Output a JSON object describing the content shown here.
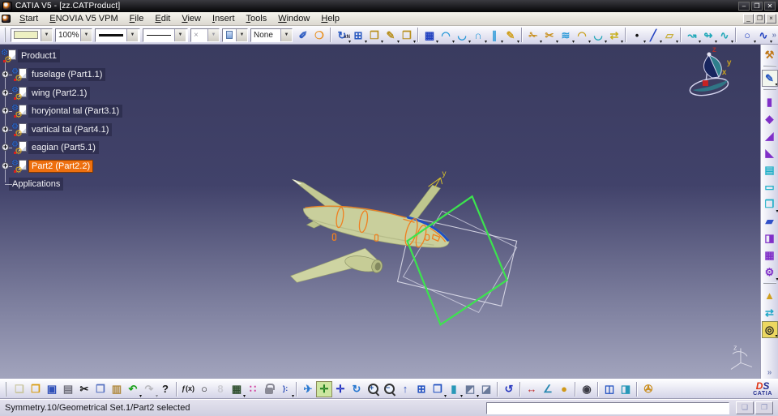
{
  "window": {
    "title": "CATIA V5 - [zz.CATProduct]",
    "controls": {
      "minimize": "–",
      "maximize": "❐",
      "close": "✕"
    },
    "child_controls": {
      "minimize": "_",
      "restore": "❐",
      "close": "×"
    }
  },
  "menu": {
    "items": [
      "Start",
      "ENOVIA V5 VPM",
      "File",
      "Edit",
      "View",
      "Insert",
      "Tools",
      "Window",
      "Help"
    ]
  },
  "graphic_props": {
    "fill_color": "#edf0c2",
    "opacity": "100%",
    "point_symbol": "×",
    "render_style": "None"
  },
  "top_toolbar": {
    "overflow_chevron": "»",
    "groups": [
      [
        {
          "n": "painter",
          "g": "✐",
          "c": "#2858c0"
        },
        {
          "n": "wizard",
          "g": "❍",
          "c": "#e89020"
        }
      ],
      [
        {
          "n": "paste-multiple-xn",
          "g": "↻",
          "c": "#2858c0",
          "sub": "xN",
          "dd": true
        },
        {
          "n": "grid",
          "g": "⊞",
          "c": "#2858c0",
          "dd": true
        },
        {
          "n": "clipboard",
          "g": "❒",
          "c": "#b89020",
          "dd": true
        },
        {
          "n": "toolbox",
          "g": "✎",
          "c": "#b89020",
          "dd": true
        },
        {
          "n": "catalog-browser",
          "g": "❐",
          "c": "#b89020",
          "dd": true
        }
      ],
      [
        {
          "n": "quick-surfaces",
          "g": "▦",
          "c": "#2040c0",
          "dd": true
        },
        {
          "n": "sweep-surface",
          "g": "◠",
          "c": "#2898d8",
          "dd": true
        },
        {
          "n": "fill-surface",
          "g": "◡",
          "c": "#2898d8",
          "dd": true
        },
        {
          "n": "loft-surface",
          "g": "∩",
          "c": "#2898d8",
          "dd": true
        },
        {
          "n": "offset-surface",
          "g": "∥",
          "c": "#2898d8",
          "dd": true
        },
        {
          "n": "styling-sweep",
          "g": "✎",
          "c": "#d0a020",
          "dd": true
        }
      ],
      [
        {
          "n": "join",
          "g": "✁",
          "c": "#c89020",
          "dd": true
        },
        {
          "n": "split",
          "g": "✂",
          "c": "#c89020",
          "dd": true
        },
        {
          "n": "trim",
          "g": "≋",
          "c": "#2898d8",
          "dd": true
        },
        {
          "n": "boundary",
          "g": "◠",
          "c": "#c8a020",
          "dd": true
        },
        {
          "n": "extract",
          "g": "◡",
          "c": "#20a8b8",
          "dd": true
        },
        {
          "n": "shape-morphing",
          "g": "⇄",
          "c": "#c8b020",
          "dd": true
        }
      ],
      [
        {
          "n": "point",
          "g": "•",
          "c": "#101010",
          "dd": true
        },
        {
          "n": "line",
          "g": "╱",
          "c": "#2040c0",
          "dd": true
        },
        {
          "n": "plane",
          "g": "▱",
          "c": "#c8b040",
          "dd": true
        }
      ],
      [
        {
          "n": "projection",
          "g": "↝",
          "c": "#20a8b8",
          "dd": true
        },
        {
          "n": "intersection",
          "g": "↬",
          "c": "#20a8b8",
          "dd": true
        },
        {
          "n": "reflect-line",
          "g": "∿",
          "c": "#20a8b8",
          "dd": true
        }
      ],
      [
        {
          "n": "circle",
          "g": "○",
          "c": "#2040c0",
          "dd": true
        },
        {
          "n": "spline",
          "g": "∿",
          "c": "#2040c0",
          "dd": true
        }
      ]
    ]
  },
  "right_toolbar": {
    "overflow_chevron": "»",
    "items": [
      {
        "n": "exit-workbench",
        "g": "⚒",
        "c": "#c07818"
      },
      {
        "grip": true
      },
      {
        "n": "sketcher",
        "g": "✎",
        "c": "#2858c0",
        "dd": true,
        "boxed": true
      },
      {
        "grip": true
      },
      {
        "n": "pad",
        "g": "▮",
        "c": "#8030c8"
      },
      {
        "n": "drafted-filleted-pad",
        "g": "◆",
        "c": "#8030c8"
      },
      {
        "n": "pocket",
        "g": "◢",
        "c": "#8030c8"
      },
      {
        "n": "groove",
        "g": "◣",
        "c": "#8030c8"
      },
      {
        "n": "shell",
        "g": "▤",
        "c": "#20b0c8"
      },
      {
        "n": "remove-face",
        "g": "▭",
        "c": "#20b0c8"
      },
      {
        "n": "boolean-operation",
        "g": "❒",
        "c": "#20b0c8",
        "dd": true
      },
      {
        "n": "split-body",
        "g": "▰",
        "c": "#3050c8"
      },
      {
        "n": "close-surface",
        "g": "◨",
        "c": "#8030c8"
      },
      {
        "n": "sew-surface",
        "g": "▦",
        "c": "#8030c8"
      },
      {
        "n": "transformations",
        "g": "⚙",
        "c": "#8030c8",
        "dd": true
      },
      {
        "grip": true
      },
      {
        "n": "scaling",
        "g": "▲",
        "c": "#d0a020"
      },
      {
        "n": "mirror",
        "g": "⇄",
        "c": "#20a8c8"
      },
      {
        "n": "hole",
        "g": "◎",
        "c": "#202020",
        "bg": "#ecd860",
        "dd": true
      }
    ]
  },
  "bottom_toolbar": {
    "groups": [
      [
        {
          "n": "new-document",
          "g": "❏",
          "c": "#c8c49c"
        },
        {
          "n": "open",
          "g": "❐",
          "c": "#d89c10"
        },
        {
          "n": "save",
          "g": "▣",
          "c": "#3050b8"
        },
        {
          "n": "print",
          "g": "▤",
          "c": "#70707c"
        },
        {
          "n": "cut",
          "g": "✂",
          "c": "#1a1a1a"
        },
        {
          "n": "copy",
          "g": "❒",
          "c": "#5570c0"
        },
        {
          "n": "paste",
          "g": "▥",
          "c": "#b08a40"
        },
        {
          "n": "undo",
          "g": "↶",
          "c": "#18a018",
          "dd": true
        },
        {
          "n": "redo",
          "g": "↷",
          "c": "#707070",
          "dd": true,
          "dis": true
        },
        {
          "n": "whats-this",
          "g": "?",
          "c": "#1a1a1a"
        }
      ],
      [
        {
          "n": "formula",
          "g": "ƒ(x)",
          "c": "#1a1a1a",
          "small": true
        },
        {
          "n": "comment",
          "g": "○",
          "c": "#1a1a1a"
        },
        {
          "n": "knowledge-link",
          "g": "8",
          "c": "#a0a0a8",
          "dis": true
        },
        {
          "n": "design-table",
          "g": "▦",
          "c": "#2f4f2f",
          "dd": true
        },
        {
          "n": "product-structure",
          "g": "∷",
          "c": "#d03a9a"
        },
        {
          "n": "lock",
          "lock": true
        },
        {
          "n": "rule-editor",
          "g": "}:",
          "c": "#3050b8",
          "small": true,
          "dd": true
        }
      ],
      [
        {
          "n": "fly-mode",
          "g": "✈",
          "c": "#2878d0"
        },
        {
          "n": "fit-all-in",
          "g": "✛",
          "c": "#1f7f1f",
          "bg": "#cde6a0"
        },
        {
          "n": "pan",
          "g": "✛",
          "c": "#2030c0"
        },
        {
          "n": "rotate",
          "g": "↻",
          "c": "#2878d0"
        },
        {
          "n": "zoom-in",
          "mag": "+"
        },
        {
          "n": "zoom-out",
          "mag": "−"
        },
        {
          "n": "normal-view",
          "g": "↑",
          "c": "#3050b8"
        },
        {
          "n": "multi-view",
          "g": "⊞",
          "c": "#2050c0"
        },
        {
          "n": "isometric-view",
          "g": "❒",
          "c": "#2050c0",
          "dd": true
        },
        {
          "n": "render-style",
          "g": "▮",
          "c": "#2898b8",
          "dd": true
        },
        {
          "n": "view-mode-shading",
          "g": "◩",
          "c": "#6a7a9a",
          "dd": true
        },
        {
          "n": "view-mode-edges",
          "g": "◪",
          "c": "#6a7a9a"
        }
      ],
      [
        {
          "n": "turntable",
          "g": "↺",
          "c": "#2838c0"
        }
      ],
      [
        {
          "n": "measure-between",
          "g": "↔",
          "c": "#c03030"
        },
        {
          "n": "measure-item",
          "g": "∠",
          "c": "#2888b0"
        },
        {
          "n": "measure-inertia",
          "g": "●",
          "c": "#d09818"
        }
      ],
      [
        {
          "n": "instant-snapshot",
          "g": "◉",
          "c": "#3a3a44"
        }
      ],
      [
        {
          "n": "sectioning",
          "g": "◫",
          "c": "#2050c0"
        },
        {
          "n": "depth-effect",
          "g": "◨",
          "c": "#2898b8"
        }
      ],
      [
        {
          "n": "clamp",
          "g": "✇",
          "c": "#c88a18"
        }
      ]
    ]
  },
  "brand": {
    "ds": "DS",
    "catia": "CATIA"
  },
  "tree": {
    "root": "Product1",
    "items": [
      {
        "label": "fuselage (Part1.1)",
        "selected": false
      },
      {
        "label": "wing (Part2.1)",
        "selected": false
      },
      {
        "label": "horyjontal tal (Part3.1)",
        "selected": false
      },
      {
        "label": "vartical tal (Part4.1)",
        "selected": false
      },
      {
        "label": "eagian (Part5.1)",
        "selected": false
      },
      {
        "label": "Part2 (Part2.2)",
        "selected": true
      }
    ],
    "footer": "Applications",
    "expander_glyph": "+"
  },
  "scene": {
    "compass_z": "z",
    "compass_y": "y",
    "compass_x": "x",
    "tail_axis_label": "y",
    "triad_label": "z",
    "plane_color": "#3ce44e",
    "highlight_color": "#f08020",
    "model_color": "#c9cf9c"
  },
  "status": {
    "message": "Symmetry.10/Geometrical Set.1/Part2 selected",
    "power_input_value": ""
  }
}
